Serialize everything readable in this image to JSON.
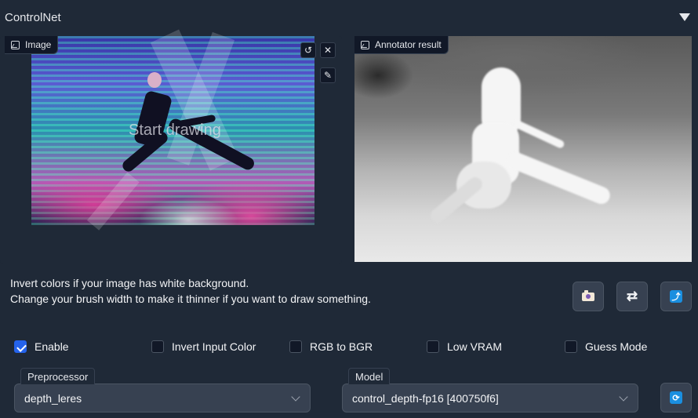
{
  "header": {
    "title": "ControlNet"
  },
  "image_panel": {
    "label": "Image",
    "overlay_text": "Start drawing"
  },
  "annotator_panel": {
    "label": "Annotator result"
  },
  "info": {
    "line1": "Invert colors if your image has white background.",
    "line2": "Change your brush width to make it thinner if you want to draw something."
  },
  "options": [
    {
      "label": "Enable",
      "checked": true
    },
    {
      "label": "Invert Input Color",
      "checked": false
    },
    {
      "label": "RGB to BGR",
      "checked": false
    },
    {
      "label": "Low VRAM",
      "checked": false
    },
    {
      "label": "Guess Mode",
      "checked": false
    }
  ],
  "preprocessor": {
    "label": "Preprocessor",
    "value": "depth_leres"
  },
  "model": {
    "label": "Model",
    "value": "control_depth-fp16 [400750f6]"
  },
  "icons": {
    "tool_undo": "↺",
    "tool_close": "✕",
    "tool_brush": "✎",
    "swap": "⇄",
    "blue_action": "⤴",
    "refresh": "⟳"
  },
  "colors": {
    "background": "#1f2937",
    "checkbox_checked": "#2563eb",
    "accent_blue": "#1a8fe0"
  }
}
